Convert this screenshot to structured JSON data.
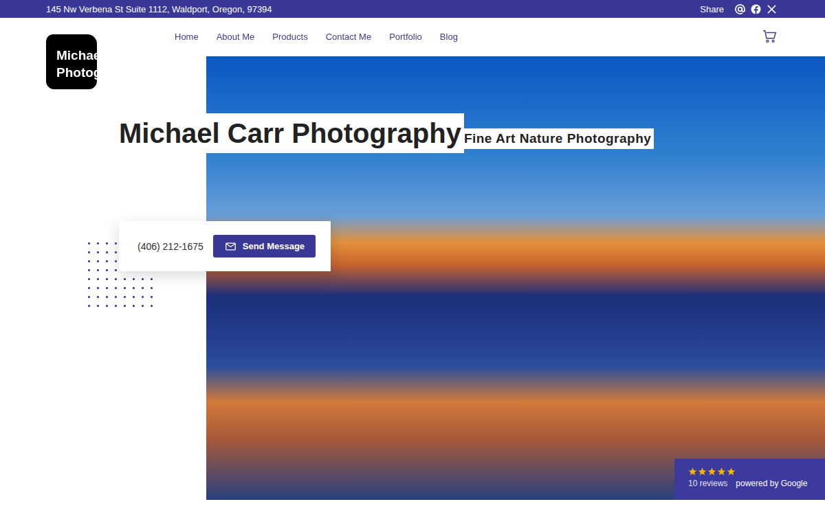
{
  "top_bar": {
    "address": "145 Nw Verbena St Suite 1112, Waldport, Oregon, 97394",
    "share_label": "Share"
  },
  "logo": {
    "lines": [
      "Michael Carr",
      "Photography"
    ]
  },
  "nav": {
    "items": [
      {
        "label": "Home",
        "selected": false
      },
      {
        "label": "About Me",
        "selected": false
      },
      {
        "label": "Products",
        "selected": false
      },
      {
        "label": "Contact Me",
        "selected": false
      },
      {
        "label": "Portfolio",
        "selected": false
      },
      {
        "label": "Blog",
        "selected": false
      }
    ]
  },
  "hero": {
    "title": "Michael Carr Photography",
    "subtitle": "Fine Art Nature Photography"
  },
  "contact": {
    "phone": "(406) 212-1675",
    "button": "Send Message"
  },
  "reviews": {
    "stars": 5,
    "count": "10 reviews",
    "provider": "powered by Google"
  }
}
